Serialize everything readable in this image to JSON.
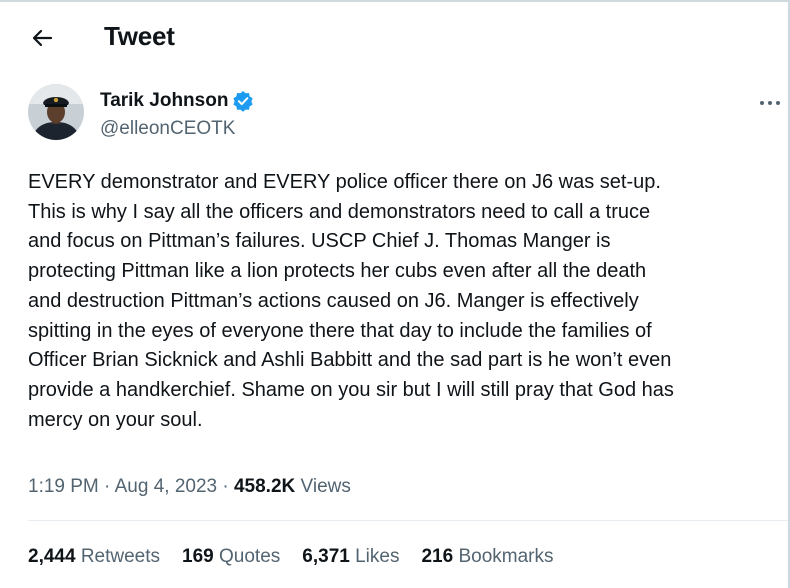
{
  "header": {
    "title": "Tweet"
  },
  "author": {
    "name": "Tarik Johnson",
    "handle": "@elleonCEOTK",
    "verified": true
  },
  "tweet": {
    "text": "EVERY demonstrator and EVERY police officer there on J6 was set-up.\nThis is why I say all the officers and demonstrators need to call a truce\nand focus on Pittman’s failures. USCP Chief J. Thomas Manger is\nprotecting Pittman like a lion protects her cubs even after all the death\nand destruction Pittman’s actions caused on J6. Manger is effectively\nspitting in the eyes of everyone there that day to include the families of\nOfficer Brian Sicknick and Ashli Babbitt and the sad part is he won’t even\nprovide a handkerchief. Shame on you sir but I will still pray that God has\nmercy on your soul."
  },
  "meta": {
    "time": "1:19 PM",
    "separator": "·",
    "date": "Aug 4, 2023",
    "views_count": "458.2K",
    "views_label": "Views"
  },
  "stats": [
    {
      "count": "2,444",
      "label": "Retweets"
    },
    {
      "count": "169",
      "label": "Quotes"
    },
    {
      "count": "6,371",
      "label": "Likes"
    },
    {
      "count": "216",
      "label": "Bookmarks"
    }
  ],
  "colors": {
    "verified": "#1d9bf0",
    "secondary_text": "#536471",
    "primary_text": "#0f1419"
  }
}
